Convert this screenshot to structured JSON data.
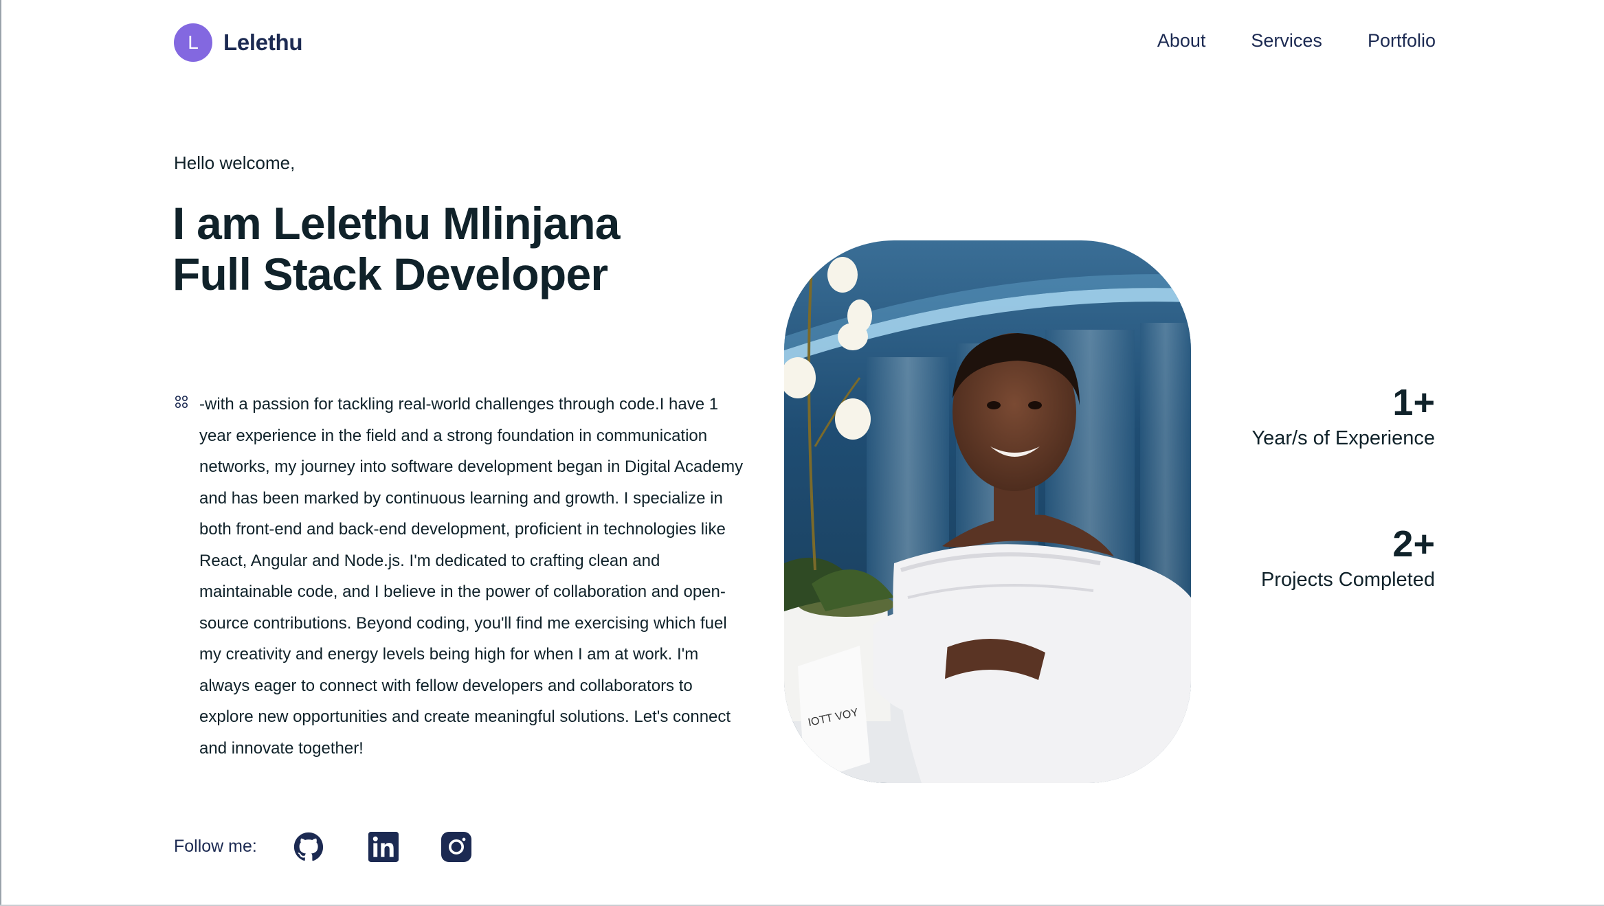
{
  "header": {
    "avatar_letter": "L",
    "brand_name": "Lelethu",
    "nav": [
      {
        "label": "About"
      },
      {
        "label": "Services"
      },
      {
        "label": "Portfolio"
      }
    ]
  },
  "hero": {
    "greeting": "Hello welcome,",
    "headline_line1": "I am Lelethu Mlinjana",
    "headline_line2": "Full Stack Developer",
    "bio_icon": "grid-dots-icon",
    "bio": "-with a passion for tackling real-world challenges through code.I have 1 year experience in the field and a strong foundation in communication networks, my journey into software development began in Digital Academy and has been marked by continuous learning and growth. I specialize in both front-end and back-end development, proficient in technologies like React, Angular and Node.js. I'm dedicated to crafting clean and maintainable code, and I believe in the power of collaboration and open-source contributions. Beyond coding, you'll find me exercising which fuel my creativity and energy levels being high for when I am at work. I'm always eager to connect with fellow developers and collaborators to explore new opportunities and create meaningful solutions. Let's connect and innovate together!"
  },
  "photo_sign_text": "IOTT VOY",
  "stats": [
    {
      "value": "1+",
      "label": "Year/s of Experience"
    },
    {
      "value": "2+",
      "label": "Projects Completed"
    }
  ],
  "follow": {
    "label": "Follow me:",
    "icons": [
      "github-icon",
      "linkedin-icon",
      "instagram-icon"
    ]
  },
  "colors": {
    "brand_avatar": "#8368e0",
    "nav_text": "#1c2a52",
    "heading_text": "#10222a",
    "social_icon": "#1c2a52"
  }
}
